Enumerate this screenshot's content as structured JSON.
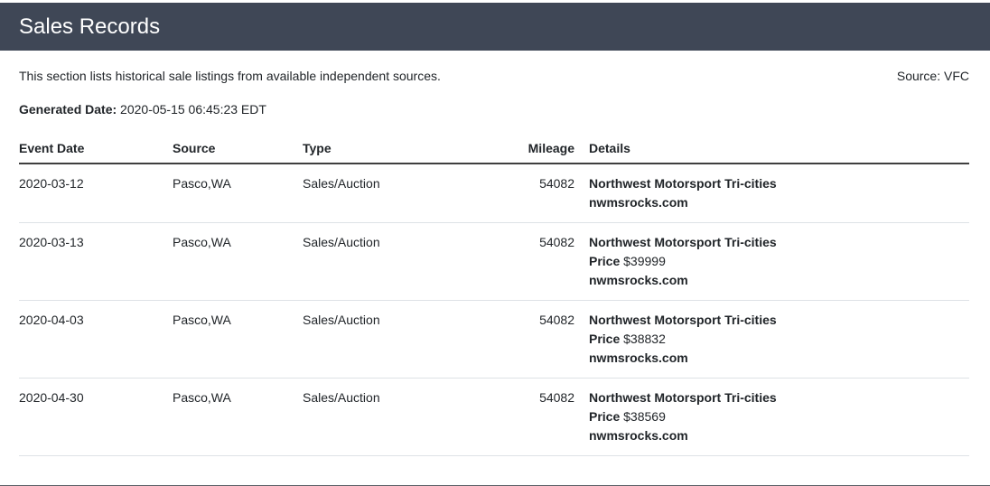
{
  "header": {
    "title": "Sales Records"
  },
  "intro": {
    "text": "This section lists historical sale listings from available independent sources.",
    "source": "Source: VFC"
  },
  "generated": {
    "label": "Generated Date:",
    "value": "2020-05-15 06:45:23 EDT"
  },
  "table": {
    "columns": [
      "Event Date",
      "Source",
      "Type",
      "Mileage",
      "Details"
    ],
    "rows": [
      {
        "date": "2020-03-12",
        "source": "Pasco,WA",
        "type": "Sales/Auction",
        "mileage": "54082",
        "dealer": "Northwest Motorsport Tri-cities",
        "price_label": "",
        "price": "",
        "site": "nwmsrocks.com"
      },
      {
        "date": "2020-03-13",
        "source": "Pasco,WA",
        "type": "Sales/Auction",
        "mileage": "54082",
        "dealer": "Northwest Motorsport Tri-cities",
        "price_label": "Price",
        "price": "$39999",
        "site": "nwmsrocks.com"
      },
      {
        "date": "2020-04-03",
        "source": "Pasco,WA",
        "type": "Sales/Auction",
        "mileage": "54082",
        "dealer": "Northwest Motorsport Tri-cities",
        "price_label": "Price",
        "price": "$38832",
        "site": "nwmsrocks.com"
      },
      {
        "date": "2020-04-30",
        "source": "Pasco,WA",
        "type": "Sales/Auction",
        "mileage": "54082",
        "dealer": "Northwest Motorsport Tri-cities",
        "price_label": "Price",
        "price": "$38569",
        "site": "nwmsrocks.com"
      }
    ]
  }
}
